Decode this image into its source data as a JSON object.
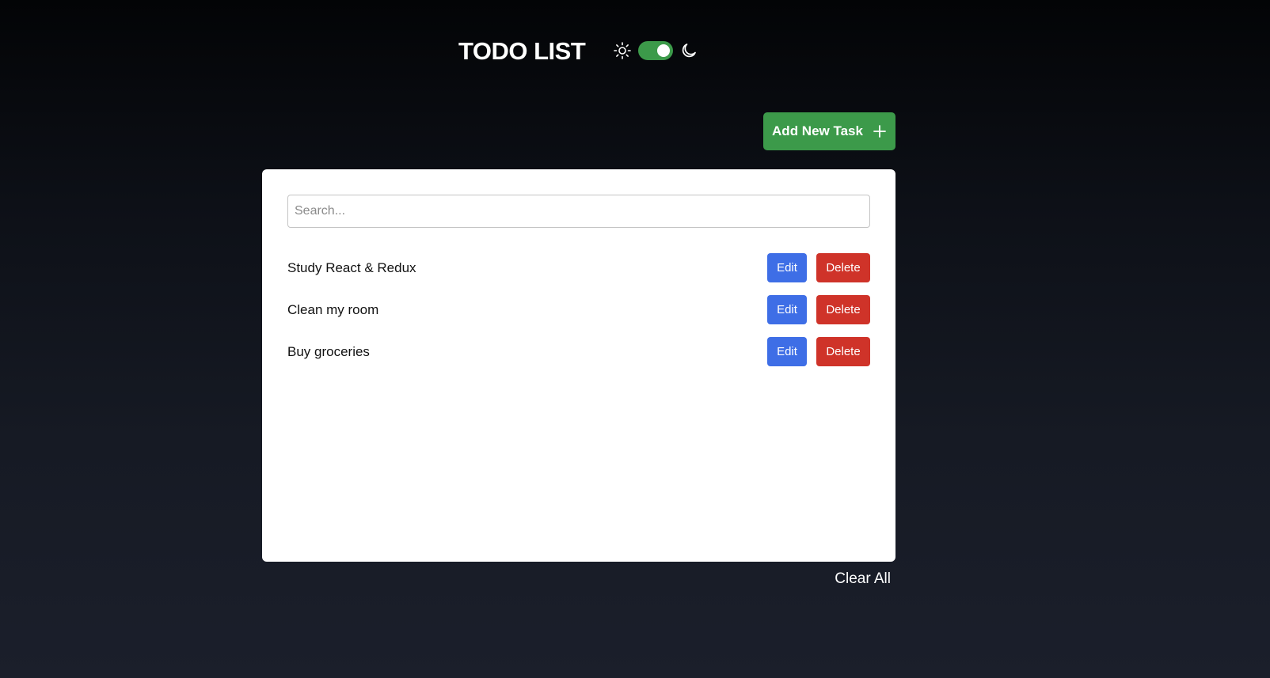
{
  "header": {
    "title": "TODO LIST",
    "theme_toggle": {
      "enabled": true,
      "color": "#3c9a4a",
      "left_icon": "sun-icon",
      "right_icon": "moon-icon"
    }
  },
  "toolbar": {
    "add_label": "Add New Task",
    "add_icon": "plus-icon",
    "add_color": "#3c9a4a"
  },
  "search": {
    "placeholder": "Search...",
    "value": ""
  },
  "tasks": [
    {
      "text": "Study React & Redux",
      "edit_label": "Edit",
      "delete_label": "Delete"
    },
    {
      "text": "Clean my room",
      "edit_label": "Edit",
      "delete_label": "Delete"
    },
    {
      "text": "Buy groceries",
      "edit_label": "Edit",
      "delete_label": "Delete"
    }
  ],
  "colors": {
    "edit": "#3e6ee6",
    "delete": "#cf3329",
    "card": "#ffffff"
  },
  "footer": {
    "clear_label": "Clear All"
  }
}
